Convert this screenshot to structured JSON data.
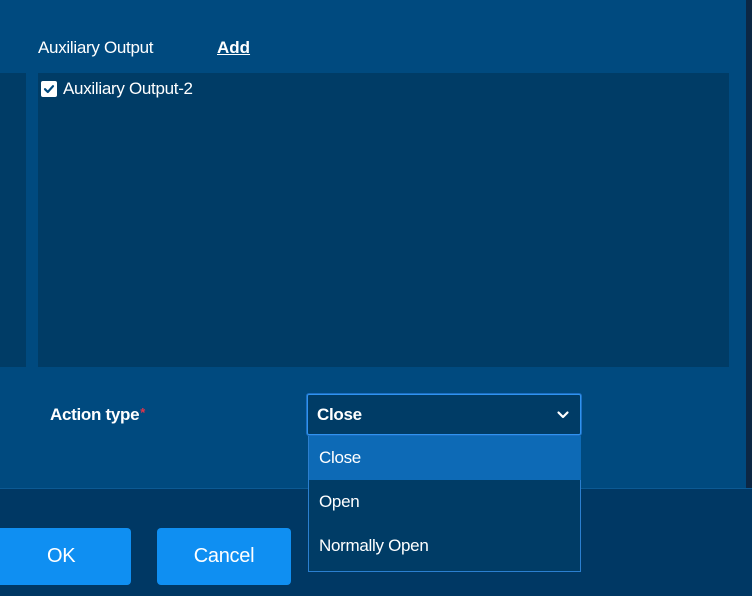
{
  "auxiliary_output": {
    "header_label": "Auxiliary Output",
    "add_link": "Add",
    "items": [
      {
        "label": "Auxiliary Output-2",
        "checked": true
      }
    ]
  },
  "action_type": {
    "label": "Action type",
    "required_mark": "*",
    "selected_value": "Close",
    "options": [
      "Close",
      "Open",
      "Normally Open"
    ]
  },
  "footer": {
    "ok_label": "OK",
    "cancel_label": "Cancel"
  },
  "colors": {
    "panel_bg": "#004a7f",
    "list_bg": "#003c66",
    "accent": "#0f8ff2",
    "highlight": "#0d6ab6",
    "required": "#e0344a"
  },
  "icons": {
    "checkbox": "checkbox-checked-icon",
    "dropdown": "chevron-down-icon"
  }
}
